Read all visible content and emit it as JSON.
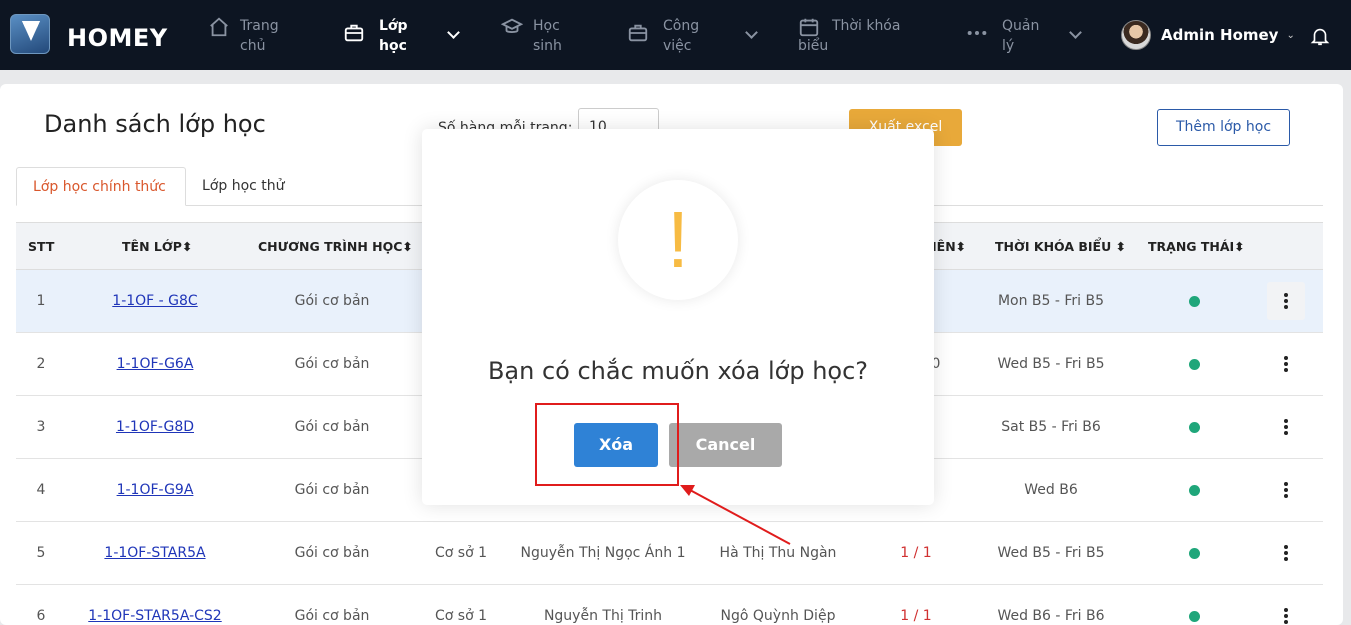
{
  "nav": {
    "brand": "HOMEY",
    "items": [
      {
        "label": "Trang chủ",
        "icon": "home-icon"
      },
      {
        "label": "Lớp học",
        "icon": "briefcase-icon",
        "active": true
      },
      {
        "label": "Học sinh",
        "icon": "graduation-cap-icon"
      },
      {
        "label": "Công việc",
        "icon": "briefcase-icon"
      },
      {
        "label": "Thời khóa biểu",
        "icon": "calendar-icon"
      },
      {
        "label": "Quản lý",
        "icon": "more-dots-icon"
      }
    ],
    "user_name": "Admin Homey"
  },
  "page": {
    "title": "Danh sách lớp học",
    "rows_per_page_label": "Số hàng mỗi trang:",
    "rows_per_page_value": "10",
    "export_label": "Xuất excel",
    "add_label": "Thêm lớp học"
  },
  "tabs": [
    "Lớp học chính thức",
    "Lớp học thử"
  ],
  "table": {
    "headers": {
      "stt": "STT",
      "name": "TÊN LỚP",
      "program": "CHƯƠNG TRÌNH HỌC",
      "teacher": "IÊN",
      "schedule": "THỜI KHÓA BIỂU",
      "status": "TRẠNG THÁI"
    },
    "rows": [
      {
        "stt": "1",
        "name": "1-1OF - G8C",
        "program": "Gói cơ bản",
        "branch": "",
        "teacher": "",
        "assistant": "",
        "count": "",
        "schedule": "Mon B5 - Fri B5"
      },
      {
        "stt": "2",
        "name": "1-1OF-G6A",
        "program": "Gói cơ bản",
        "branch": "",
        "teacher": "",
        "assistant": "",
        "count": "0",
        "schedule": "Wed B5 - Fri B5"
      },
      {
        "stt": "3",
        "name": "1-1OF-G8D",
        "program": "Gói cơ bản",
        "branch": "",
        "teacher": "",
        "assistant": "",
        "count": "",
        "schedule": "Sat B5 - Fri B6"
      },
      {
        "stt": "4",
        "name": "1-1OF-G9A",
        "program": "Gói cơ bản",
        "branch": "",
        "teacher": "",
        "assistant": "",
        "count": "",
        "schedule": "Wed B6"
      },
      {
        "stt": "5",
        "name": "1-1OF-STAR5A",
        "program": "Gói cơ bản",
        "branch": "Cơ sở 1",
        "teacher": "Nguyễn Thị Ngọc Ánh 1",
        "assistant": "Hà Thị Thu Ngàn",
        "count": "1 / 1",
        "schedule": "Wed B5 - Fri B5"
      },
      {
        "stt": "6",
        "name": "1-1OF-STAR5A-CS2",
        "program": "Gói cơ bản",
        "branch": "Cơ sở 1",
        "teacher": "Nguyễn Thị Trinh",
        "assistant": "Ngô Quỳnh Diệp",
        "count": "1 / 1",
        "schedule": "Wed B6 - Fri B6"
      }
    ]
  },
  "modal": {
    "icon": "!",
    "question": "Bạn có chắc muốn xóa lớp học?",
    "confirm_label": "Xóa",
    "cancel_label": "Cancel"
  },
  "colors": {
    "nav_bg": "#0d1522",
    "accent_blue": "#2f82d6",
    "warning": "#f7bb43",
    "status_active": "#1fa67a",
    "highlight_red": "#e01c1c"
  }
}
